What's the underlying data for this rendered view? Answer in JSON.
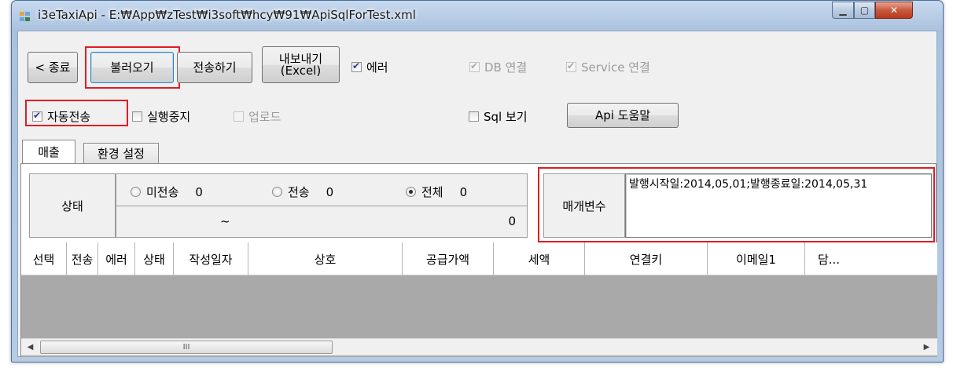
{
  "window": {
    "title": "i3eTaxiApi - E:₩App₩zTest₩i3soft₩hcy₩91₩ApiSqlForTest.xml",
    "minimize_label": "▁",
    "maximize_label": "▢",
    "close_label": "✕"
  },
  "toolbar": {
    "exit_label": "< 종료",
    "load_label": "불러오기",
    "send_label": "전송하기",
    "export_label_line1": "내보내기",
    "export_label_line2": "(Excel)",
    "error_label": "에러",
    "error_checked": true,
    "db_conn_label": "DB 연결",
    "db_conn_checked": true,
    "service_conn_label": "Service 연결",
    "service_conn_checked": true,
    "auto_send_label": "자동전송",
    "auto_send_checked": true,
    "stop_exec_label": "실행중지",
    "stop_exec_checked": false,
    "upload_label": "업로드",
    "upload_checked": false,
    "sql_view_label": "Sql 보기",
    "sql_view_checked": false,
    "api_help_label": "Api 도움말"
  },
  "tabs": [
    {
      "label": "매출",
      "active": true
    },
    {
      "label": "환경 설정",
      "active": false
    }
  ],
  "status": {
    "label": "상태",
    "radios": [
      {
        "label": "미전송",
        "count": "0",
        "checked": false
      },
      {
        "label": "전송",
        "count": "0",
        "checked": false
      },
      {
        "label": "전체",
        "count": "0",
        "checked": true
      }
    ],
    "range_text": "~",
    "progress_value": "0"
  },
  "params": {
    "label": "매개변수",
    "value": "발행시작일:2014,05,01;발행종료일:2014,05,31"
  },
  "grid": {
    "columns": [
      "선택",
      "전송",
      "에러",
      "상태",
      "작성일자",
      "상호",
      "공급가액",
      "세액",
      "연결키",
      "이메일1",
      "담..."
    ],
    "scroll_thumb_grip": "III",
    "scroll_left": "◀",
    "scroll_right": "▶"
  },
  "colors": {
    "highlight": "#e21b23",
    "grid_empty": "#a9a9a9"
  }
}
